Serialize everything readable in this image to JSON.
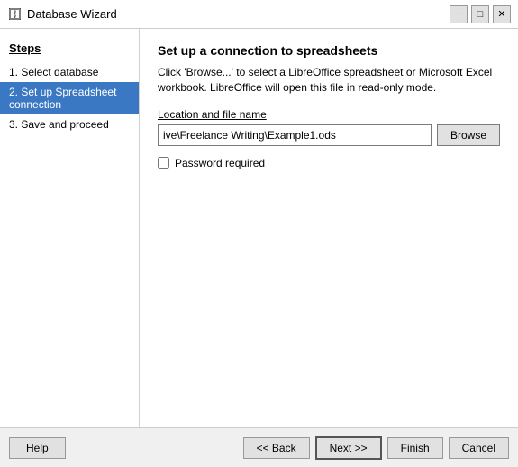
{
  "titleBar": {
    "title": "Database Wizard",
    "icon": "🗄",
    "controls": {
      "minimize": "−",
      "maximize": "□",
      "close": "✕"
    }
  },
  "sidebar": {
    "heading": "Steps",
    "items": [
      {
        "id": "step1",
        "label": "1. Select database",
        "active": false
      },
      {
        "id": "step2",
        "label": "2. Set up Spreadsheet connection",
        "active": true
      },
      {
        "id": "step3",
        "label": "3. Save and proceed",
        "active": false
      }
    ]
  },
  "panel": {
    "title": "Set up a connection to spreadsheets",
    "description": "Click 'Browse...' to select a LibreOffice spreadsheet or Microsoft Excel workbook. LibreOffice will open this file in read-only mode.",
    "fileLabel": "Location and file name",
    "fileValue": "ive\\Freelance Writing\\Example1.ods",
    "browseBtnLabel": "Browse",
    "passwordLabel": "Password required",
    "passwordChecked": false
  },
  "bottomBar": {
    "helpLabel": "Help",
    "backLabel": "<< Back",
    "nextLabel": "Next >>",
    "finishLabel": "Finish",
    "cancelLabel": "Cancel"
  }
}
